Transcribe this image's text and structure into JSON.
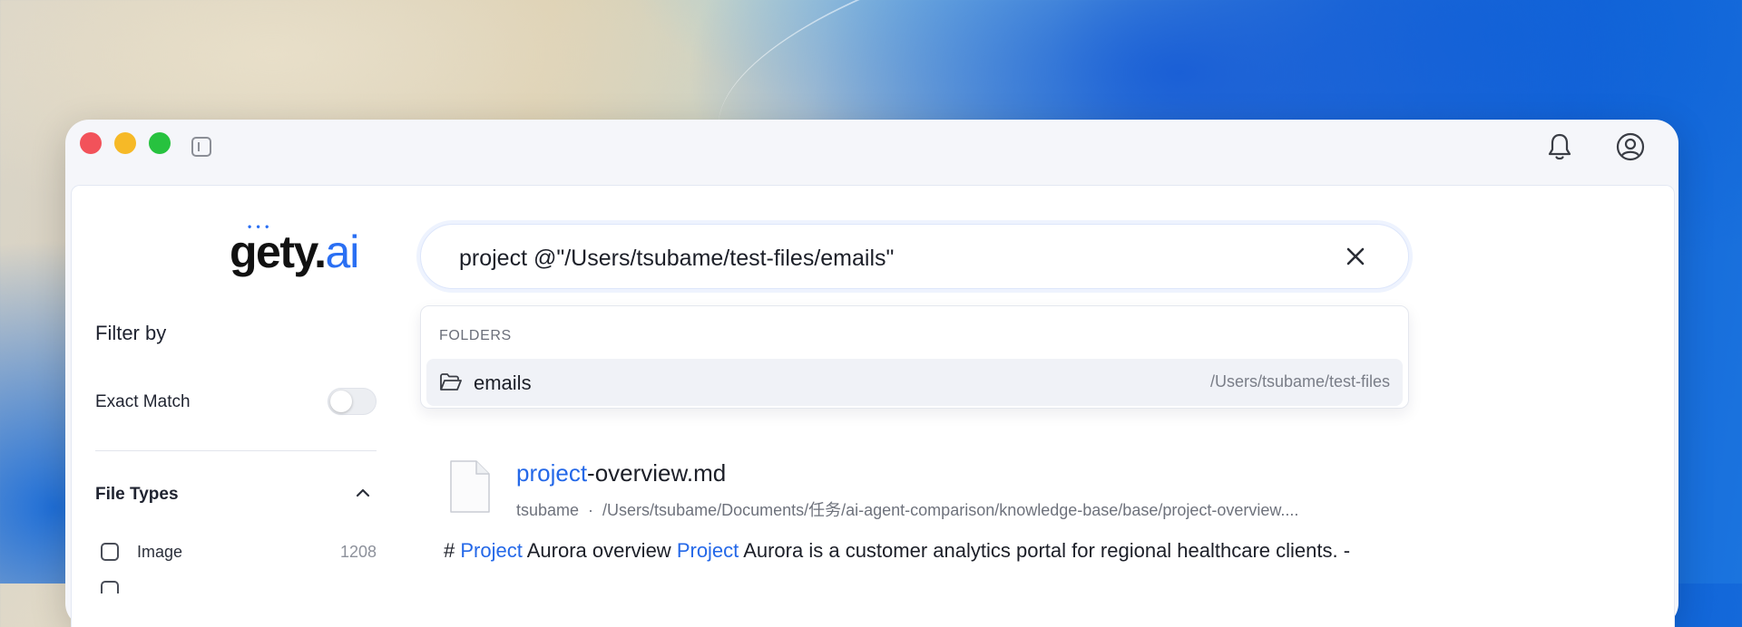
{
  "window": {
    "brand_logo": "gety.ai",
    "colors": {
      "accent": "#2468e8",
      "close": "#f2525a",
      "minimize": "#f6b927",
      "maximize": "#27c23f"
    }
  },
  "sidebar": {
    "filter_by": "Filter by",
    "exact_match_label": "Exact Match",
    "exact_match_on": false,
    "file_types_label": "File Types",
    "file_types": [
      {
        "label": "Image",
        "count": "1208",
        "checked": false
      }
    ]
  },
  "search": {
    "value": "project @\"/Users/tsubame/test-files/emails\""
  },
  "dropdown": {
    "header": "FOLDERS",
    "items": [
      {
        "name": "emails",
        "path": "/Users/tsubame/test-files",
        "icon": "folder-open-icon"
      }
    ]
  },
  "result": {
    "title_highlight": "project",
    "title_rest": "-overview.md",
    "owner": "tsubame",
    "separator": "·",
    "path": "/Users/tsubame/Documents/任务/ai-agent-comparison/knowledge-base/base/project-overview....",
    "snippet": {
      "p1": "# ",
      "h1": "Project",
      "p2": " Aurora overview ",
      "h2": "Project",
      "p3": " Aurora is a customer analytics portal for regional healthcare clients. -"
    }
  }
}
